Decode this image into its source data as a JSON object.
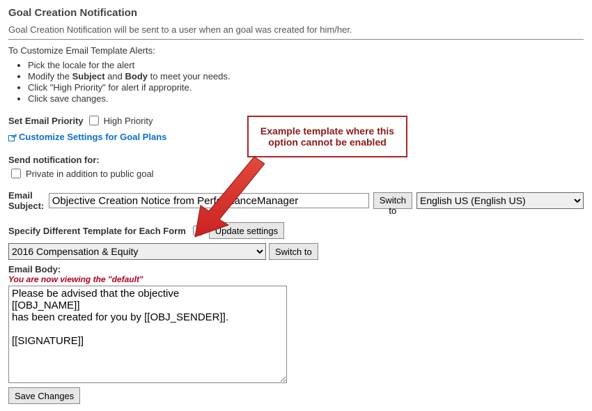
{
  "page": {
    "title": "Goal Creation Notification",
    "intro": "Goal Creation Notification will be sent to a user when an goal was created for him/her.",
    "customize_heading": "To Customize Email Template Alerts:",
    "instructions_pick": "Pick the locale for the alert",
    "instructions_modify_pre": "Modify the ",
    "instructions_modify_subject": "Subject",
    "instructions_modify_and": " and ",
    "instructions_modify_body": "Body",
    "instructions_modify_post": " to meet your needs.",
    "instructions_priority": "Click \"High Priority\" for alert if approprite.",
    "instructions_save": "Click save changes."
  },
  "priority": {
    "label": "Set Email Priority",
    "checkbox_label": "High Priority"
  },
  "customize_link": "Customize Settings for Goal Plans",
  "notification": {
    "heading": "Send notification for:",
    "private_label": "Private in addition to public goal"
  },
  "subject": {
    "label": "Email Subject:",
    "value": "Objective Creation Notice from PerformanceManager",
    "switch_btn": "Switch to",
    "language_selected": "English US (English US)"
  },
  "template": {
    "label": "Specify Different Template for Each Form",
    "update_btn": "Update settings",
    "form_selected": "2016 Compensation & Equity",
    "switch_btn": "Switch to"
  },
  "body": {
    "label": "Email Body:",
    "viewing_note": "You are now viewing the \"default\"",
    "value": "Please be advised that the objective\n[[OBJ_NAME]]\nhas been created for you by [[OBJ_SENDER]].\n\n[[SIGNATURE]]"
  },
  "save_btn": "Save Changes",
  "callout": {
    "text": "Example template where this option cannot be enabled"
  }
}
